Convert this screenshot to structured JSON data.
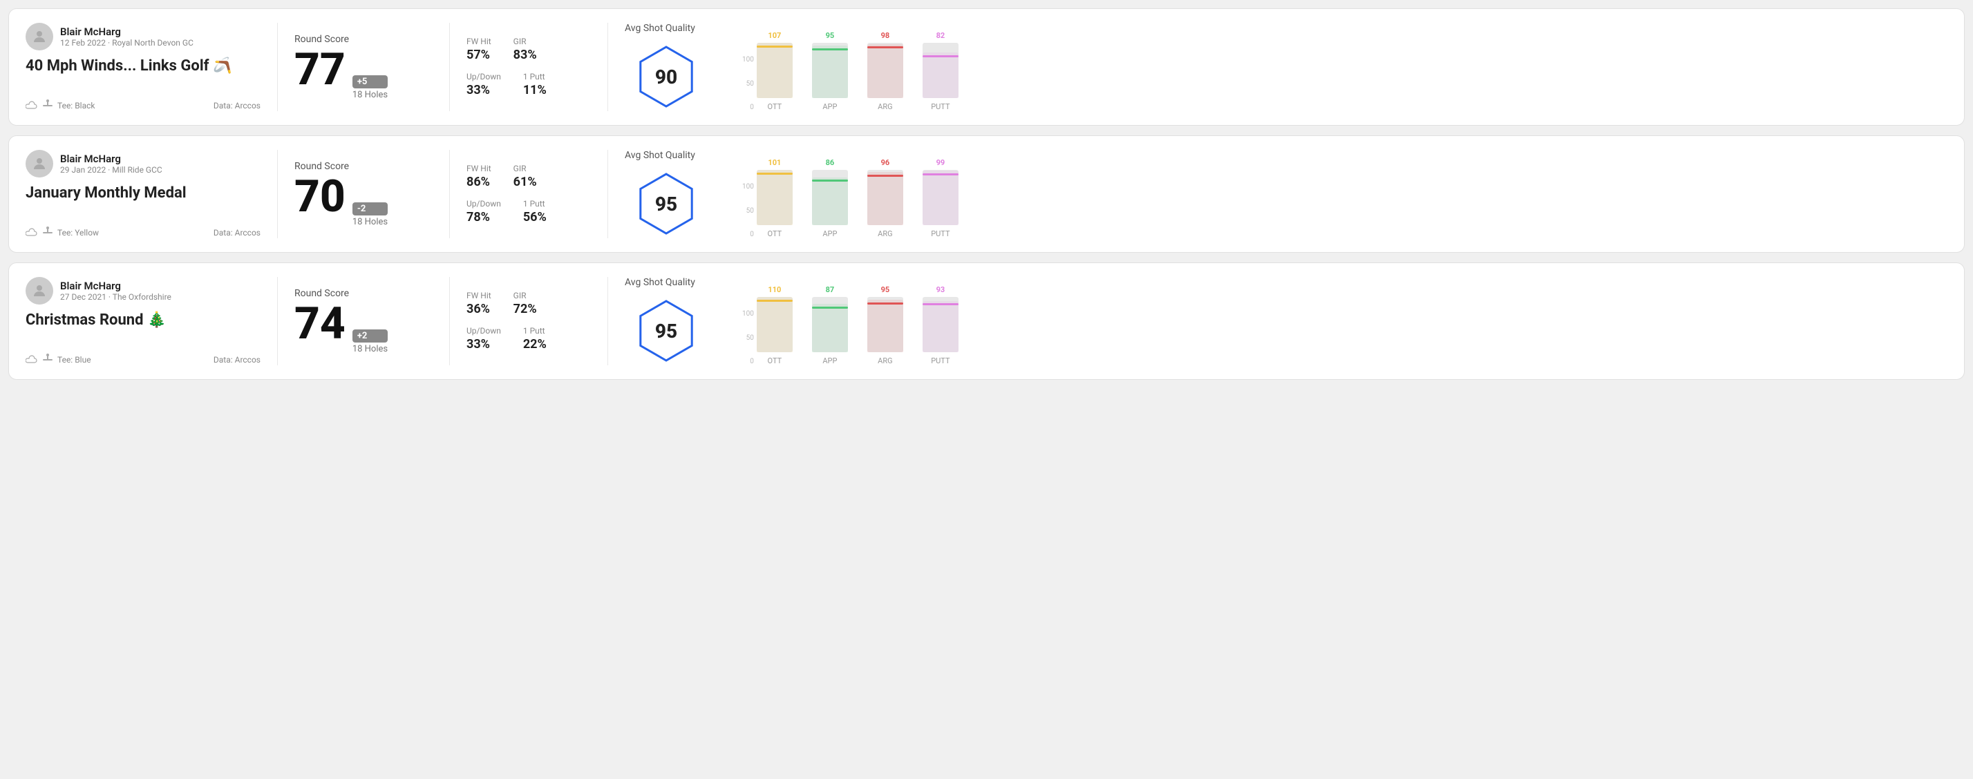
{
  "rounds": [
    {
      "id": "round-1",
      "user": {
        "name": "Blair McHarg",
        "date": "12 Feb 2022",
        "course": "Royal North Devon GC"
      },
      "title": "40 Mph Winds... Links Golf",
      "title_emoji": "🪃",
      "tee": "Black",
      "data_source": "Data: Arccos",
      "score": "77",
      "score_diff": "+5",
      "score_diff_type": "plus",
      "holes": "18 Holes",
      "fw_hit": "57%",
      "gir": "83%",
      "up_down": "33%",
      "one_putt": "11%",
      "avg_shot_quality": "90",
      "chart": {
        "bars": [
          {
            "label": "OTT",
            "value": 107,
            "color": "#f0c040",
            "line_color": "#f0c040"
          },
          {
            "label": "APP",
            "value": 95,
            "color": "#50c878",
            "line_color": "#50c878"
          },
          {
            "label": "ARG",
            "value": 98,
            "color": "#e05555",
            "line_color": "#e05555"
          },
          {
            "label": "PUTT",
            "value": 82,
            "color": "#e080e0",
            "line_color": "#e080e0"
          }
        ],
        "y_max": 120
      }
    },
    {
      "id": "round-2",
      "user": {
        "name": "Blair McHarg",
        "date": "29 Jan 2022",
        "course": "Mill Ride GCC"
      },
      "title": "January Monthly Medal",
      "title_emoji": "",
      "tee": "Yellow",
      "data_source": "Data: Arccos",
      "score": "70",
      "score_diff": "-2",
      "score_diff_type": "minus",
      "holes": "18 Holes",
      "fw_hit": "86%",
      "gir": "61%",
      "up_down": "78%",
      "one_putt": "56%",
      "avg_shot_quality": "95",
      "chart": {
        "bars": [
          {
            "label": "OTT",
            "value": 101,
            "color": "#f0c040",
            "line_color": "#f0c040"
          },
          {
            "label": "APP",
            "value": 86,
            "color": "#50c878",
            "line_color": "#50c878"
          },
          {
            "label": "ARG",
            "value": 96,
            "color": "#e05555",
            "line_color": "#e05555"
          },
          {
            "label": "PUTT",
            "value": 99,
            "color": "#e080e0",
            "line_color": "#e080e0"
          }
        ],
        "y_max": 120
      }
    },
    {
      "id": "round-3",
      "user": {
        "name": "Blair McHarg",
        "date": "27 Dec 2021",
        "course": "The Oxfordshire"
      },
      "title": "Christmas Round",
      "title_emoji": "🎄",
      "tee": "Blue",
      "data_source": "Data: Arccos",
      "score": "74",
      "score_diff": "+2",
      "score_diff_type": "plus",
      "holes": "18 Holes",
      "fw_hit": "36%",
      "gir": "72%",
      "up_down": "33%",
      "one_putt": "22%",
      "avg_shot_quality": "95",
      "chart": {
        "bars": [
          {
            "label": "OTT",
            "value": 110,
            "color": "#f0c040",
            "line_color": "#f0c040"
          },
          {
            "label": "APP",
            "value": 87,
            "color": "#50c878",
            "line_color": "#50c878"
          },
          {
            "label": "ARG",
            "value": 95,
            "color": "#e05555",
            "line_color": "#e05555"
          },
          {
            "label": "PUTT",
            "value": 93,
            "color": "#e080e0",
            "line_color": "#e080e0"
          }
        ],
        "y_max": 120
      }
    }
  ],
  "labels": {
    "round_score": "Round Score",
    "fw_hit": "FW Hit",
    "gir": "GIR",
    "up_down": "Up/Down",
    "one_putt": "1 Putt",
    "avg_shot_quality": "Avg Shot Quality",
    "tee_prefix": "Tee:",
    "y_axis": [
      "100",
      "50",
      "0"
    ]
  }
}
